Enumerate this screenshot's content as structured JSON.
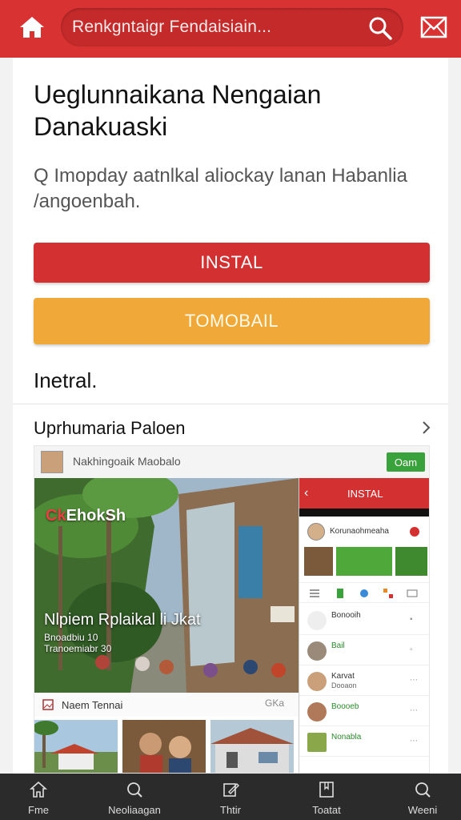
{
  "topbar": {
    "search_text": "Renkgntaigr Fendaisiain..."
  },
  "page": {
    "title": "Ueglunnaikana Nengaian Danakuaski",
    "subtitle": "Q Imopday aatnlkal aliockay lanan Habanlia /angoenbah.",
    "install_button": "INSTAL",
    "secondary_button": "TOMOBAIL",
    "section_heading": "Inetral.",
    "row_title": "Uprhumaria Paloen"
  },
  "feed": {
    "author": "Nakhingoaik Maobalo",
    "follow_label": "Oam",
    "hero_brand_accent": "Ck",
    "hero_brand": "EhokSh",
    "hero_headline": "Nlpiem Rplaikal li Jkat",
    "hero_meta_1": "Bnoadbiu 10",
    "hero_meta_2": "Tranoemiabr 30",
    "caption": "Naem Tennai",
    "caption_badge": "GKa"
  },
  "phone": {
    "title": "INSTAL",
    "back": "‹",
    "profile_name": "Korunaohmeaha",
    "list": [
      {
        "line1": "Bonooih",
        "line2": ""
      },
      {
        "line1": "Bail",
        "line2": ""
      },
      {
        "line1": "Karvat",
        "line2": "Dooaon"
      },
      {
        "line1": "Boooeb",
        "line2": ""
      },
      {
        "line1": "Nonabla",
        "line2": ""
      }
    ]
  },
  "bottom_nav": {
    "items": [
      {
        "label": "Fme",
        "icon": "home-icon"
      },
      {
        "label": "Neoliaagan",
        "icon": "search-icon"
      },
      {
        "label": "Thtir",
        "icon": "edit-icon"
      },
      {
        "label": "Toatat",
        "icon": "bookmark-icon"
      },
      {
        "label": "Weeni",
        "icon": "search-icon"
      }
    ]
  },
  "colors": {
    "brand_red": "#d83232",
    "accent_orange": "#f0a838",
    "follow_green": "#3aa23a",
    "nav_dark": "#2b2b2b"
  }
}
